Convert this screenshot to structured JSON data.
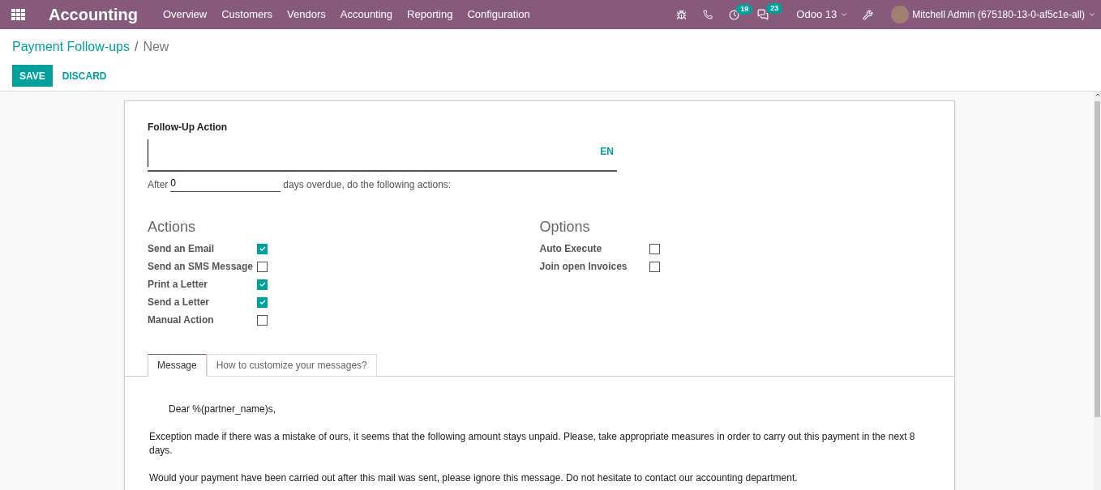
{
  "navbar": {
    "app_name": "Accounting",
    "menu": [
      "Overview",
      "Customers",
      "Vendors",
      "Accounting",
      "Reporting",
      "Configuration"
    ],
    "activity_count": "19",
    "message_count": "23",
    "database": "Odoo 13",
    "user": "Mitchell Admin (675180-13-0-af5c1e-all)"
  },
  "breadcrumb": {
    "parent": "Payment Follow-ups",
    "separator": "/",
    "current": "New"
  },
  "buttons": {
    "save": "SAVE",
    "discard": "DISCARD"
  },
  "form": {
    "title_label": "Follow-Up Action",
    "language": "EN",
    "delay_prefix": "After",
    "delay_value": "0",
    "delay_suffix": "days overdue, do the following actions:",
    "actions_title": "Actions",
    "actions": [
      {
        "label": "Send an Email",
        "checked": true
      },
      {
        "label": "Send an SMS Message",
        "checked": false
      },
      {
        "label": "Print a Letter",
        "checked": true
      },
      {
        "label": "Send a Letter",
        "checked": true
      },
      {
        "label": "Manual Action",
        "checked": false
      }
    ],
    "options_title": "Options",
    "options": [
      {
        "label": "Auto Execute",
        "checked": false
      },
      {
        "label": "Join open Invoices",
        "checked": false
      }
    ],
    "tabs": [
      {
        "label": "Message",
        "selected": true
      },
      {
        "label": "How to customize your messages?",
        "selected": false
      }
    ],
    "message": [
      "Dear %(partner_name)s,",
      "Exception made if there was a mistake of ours, it seems that the following amount stays unpaid. Please, take appropriate measures in order to carry out this payment in the next 8 days.",
      "Would your payment have been carried out after this mail was sent, please ignore this message. Do not hesitate to contact our accounting department."
    ]
  }
}
